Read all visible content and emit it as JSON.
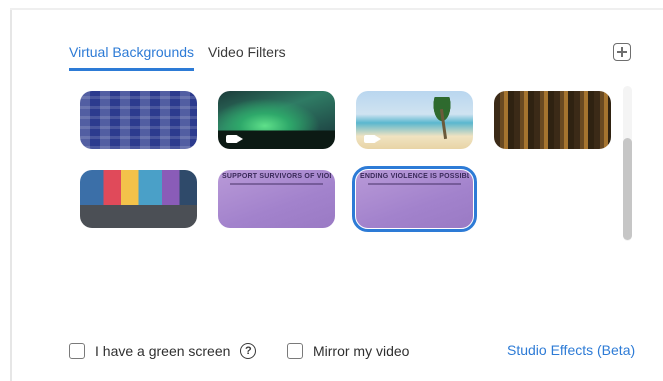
{
  "tabs": {
    "virtual_backgrounds": "Virtual Backgrounds",
    "video_filters": "Video Filters"
  },
  "add_button_icon": "plus-square-icon",
  "backgrounds": [
    {
      "id": "bg-blue-pattern",
      "label": ""
    },
    {
      "id": "bg-northern-lights",
      "label": "",
      "has_video": true
    },
    {
      "id": "bg-beach-palm",
      "label": "",
      "has_video": true
    },
    {
      "id": "bg-forest",
      "label": ""
    },
    {
      "id": "bg-colorful-office",
      "label": ""
    },
    {
      "id": "bg-support-survivors",
      "label": "SUPPORT SURVIVORS OF VIOLENC"
    },
    {
      "id": "bg-ending-violence",
      "label": "ENDING VIOLENCE IS POSSIBLE.",
      "selected": true
    }
  ],
  "options": {
    "green_screen_label": "I have a green screen",
    "help_glyph": "?",
    "mirror_label": "Mirror my video",
    "studio_effects_label": "Studio Effects (Beta)"
  },
  "colors": {
    "accent": "#2d7bd6",
    "text": "#2f2f2f"
  }
}
